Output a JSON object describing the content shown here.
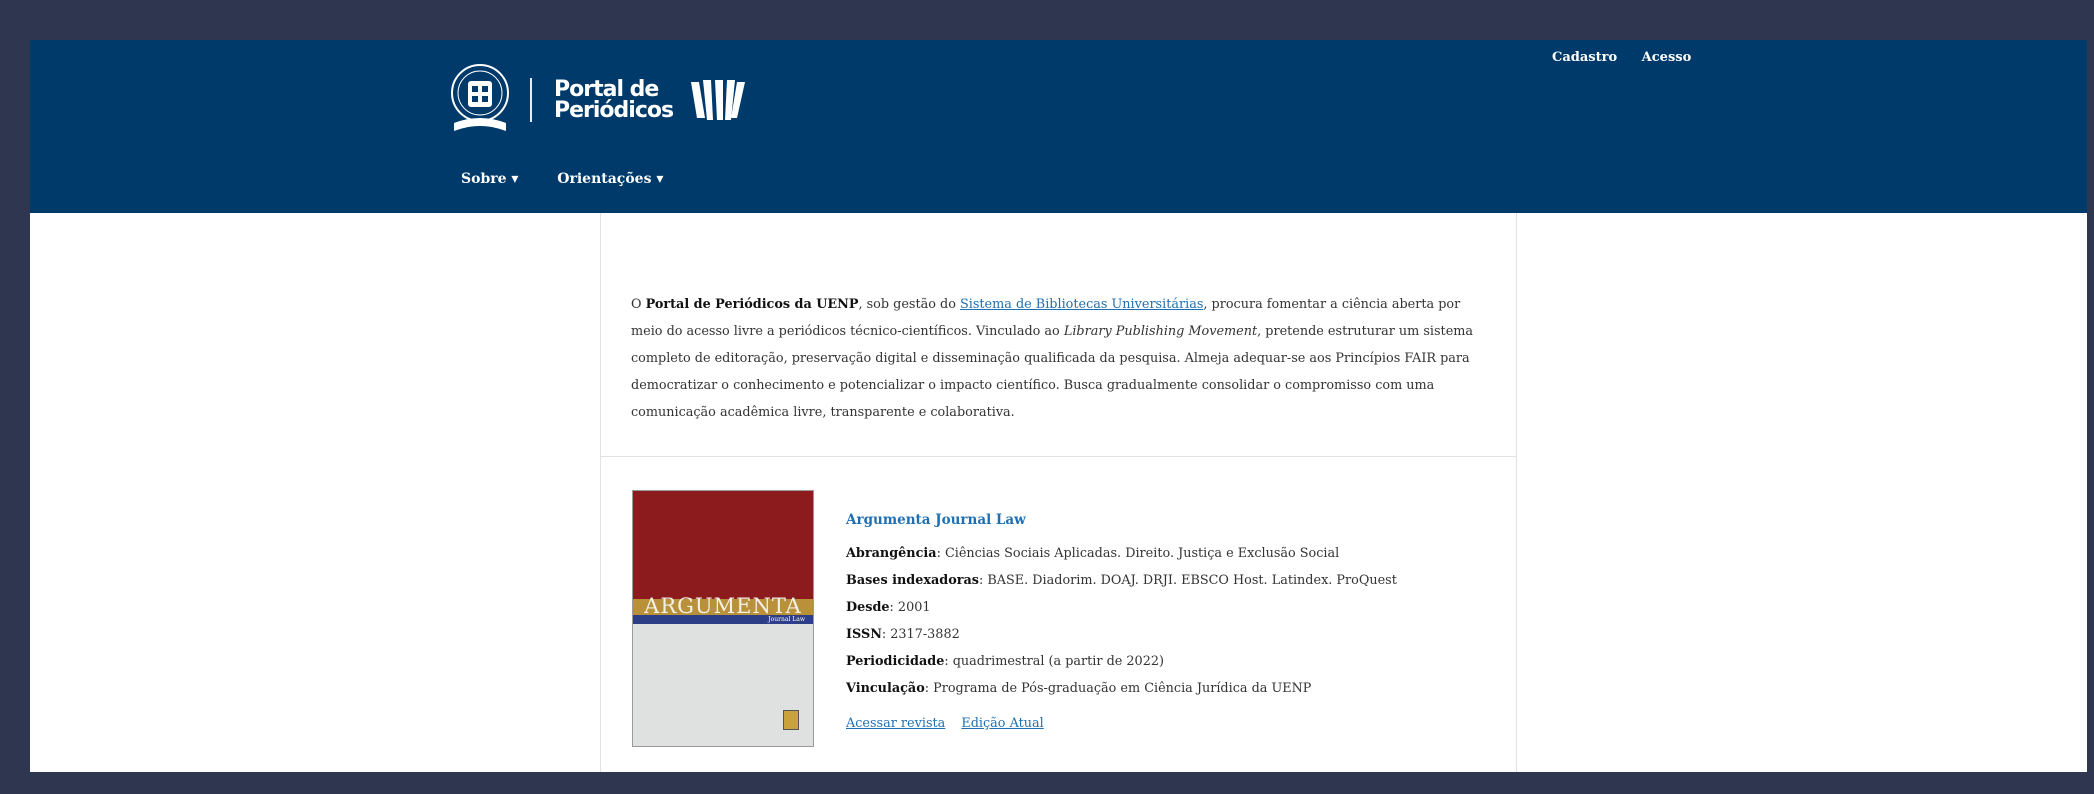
{
  "header": {
    "logo_line1": "Portal de",
    "logo_line2": "Periódicos",
    "user_nav": [
      "Cadastro",
      "Acesso"
    ],
    "main_nav": [
      {
        "label": "Sobre ▾"
      },
      {
        "label": "Orientações ▾"
      }
    ]
  },
  "intro": {
    "p1": "O ",
    "bold1": "Portal de Periódicos da UENP",
    "p2": ", sob gestão do ",
    "link": "Sistema de Bibliotecas Universitárias",
    "p3": ", procura fomentar a ciência aberta por meio do acesso livre a periódicos técnico-científicos. Vinculado ao ",
    "italic": "Library Publishing Movement",
    "p4": ", pretende estruturar um sistema completo de editoração, preservação digital e disseminação qualificada da pesquisa. Almeja adequar-se aos Princípios FAIR para democratizar o conhecimento e potencializar o impacto científico. Busca gradualmente consolidar o compromisso com uma comunicação acadêmica livre, transparente e colaborativa."
  },
  "journal": {
    "cover_title": "ARGUMENTA",
    "cover_subtitle": "Journal Law",
    "title": "Argumenta Journal Law",
    "fields": [
      {
        "label": "Abrangência",
        "value": ": Ciências Sociais Aplicadas. Direito. Justiça e Exclusão Social"
      },
      {
        "label": "Bases indexadoras",
        "value": ": BASE. Diadorim. DOAJ. DRJI. EBSCO Host. Latindex. ProQuest"
      },
      {
        "label": "Desde",
        "value": ": 2001"
      },
      {
        "label": "ISSN",
        "value": ": 2317-3882"
      },
      {
        "label": "Periodicidade",
        "value": ": quadrimestral (a partir de 2022)"
      },
      {
        "label": "Vinculação",
        "value": ": Programa de Pós-graduação em Ciência Jurídica da UENP"
      }
    ],
    "link_access": "Acessar revista",
    "link_current": "Edição Atual"
  },
  "colors": {
    "header_bg": "#003a6b",
    "outer_bg": "#2e3650",
    "link": "#1f6fb2"
  }
}
